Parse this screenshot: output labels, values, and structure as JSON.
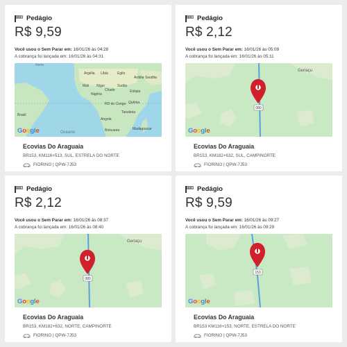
{
  "cards": [
    {
      "title": "Pedágio",
      "amount": "R$ 9,59",
      "used_label": "Você usou o Sem Parar em:",
      "used_date": "16/01/26 às 04:28",
      "charged_text": "A cobrança foi lançada em: 16/01/26 às 04:31",
      "map_type": "world",
      "map_labels": [
        "Argélia",
        "Líbia",
        "Egito",
        "Arábia Saudita",
        "Mali",
        "Níger",
        "Sudão",
        "Nigéria",
        "Chade",
        "Etiópia",
        "Quênia",
        "RD do Congo",
        "Tanzânia",
        "Angola",
        "Brasil",
        "Botsuana",
        "Madagascar",
        "Oceano",
        "Norte"
      ],
      "google": "Google",
      "company": "Ecovias Do Araguaia",
      "address": "BR153, KM116+513, SUL, ESTRELA DO NORTE",
      "vehicle": "FIORINO | QPW-7J53"
    },
    {
      "title": "Pedágio",
      "amount": "R$ 2,12",
      "used_label": "Você usou o Sem Parar em:",
      "used_date": "16/01/26 às 05:09",
      "charged_text": "A cobrança foi lançada em: 16/01/26 às 05:11",
      "map_type": "road",
      "place": "Geriaçu",
      "shield": "080",
      "google": "Google",
      "company": "Ecovias Do Araguaia",
      "address": "BR153, KM182+632, SUL, CAMPINORTE",
      "vehicle": "FIORINO | QPW-7J53"
    },
    {
      "title": "Pedágio",
      "amount": "R$ 2,12",
      "used_label": "Você usou o Sem Parar em:",
      "used_date": "16/01/26 às 08:37",
      "charged_text": "A cobrança foi lançada em: 16/01/26 às 08:40",
      "map_type": "road",
      "place": "Geriaçu",
      "shield": "080",
      "google": "Google",
      "company": "Ecovias Do Araguaia",
      "address": "BR153, KM182+632, NORTE, CAMPINORTE",
      "vehicle": "FIORINO | QPW-7J53"
    },
    {
      "title": "Pedágio",
      "amount": "R$ 9,59",
      "used_label": "Você usou o Sem Parar em:",
      "used_date": "16/01/26 às 09:27",
      "charged_text": "A cobrança foi lançada em: 16/01/26 às 09:29",
      "map_type": "road2",
      "shield": "153",
      "google": "Google",
      "company": "Ecovias Do Araguaia",
      "address": "BR153 KM116+153, NORTE, ESTRELA DO NORTE",
      "vehicle": "FIORINO | QPW-7J53"
    }
  ],
  "colors": {
    "pin": "#d0202b",
    "land": "#c9e8c4",
    "water": "#9fd6e8",
    "road": "#5aa0dd"
  },
  "icons": {
    "header": "toll-gate-icon",
    "pin": "map-pin-icon",
    "vehicle": "car-icon"
  }
}
